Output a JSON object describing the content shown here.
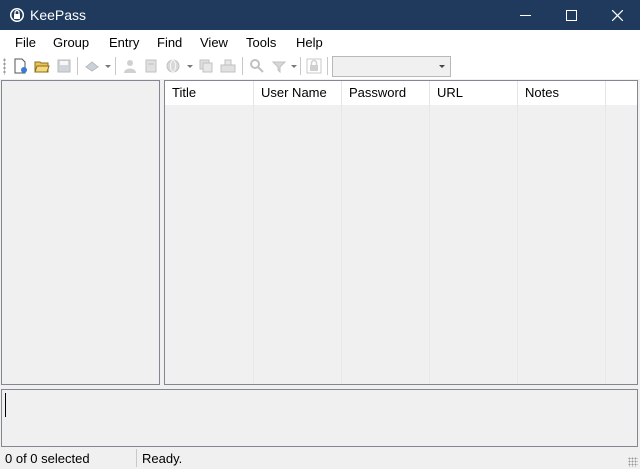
{
  "window": {
    "title": "KeePass",
    "icon": "keepass-lock-icon",
    "controls": [
      "minimize-icon",
      "maximize-icon",
      "close-icon"
    ],
    "titlebar_color": "#1f3a5c"
  },
  "menu": {
    "items": [
      "File",
      "Group",
      "Entry",
      "Find",
      "View",
      "Tools",
      "Help"
    ]
  },
  "toolbar": {
    "buttons": [
      {
        "icon": "new-database-icon",
        "enabled": true
      },
      {
        "icon": "open-database-icon",
        "enabled": true
      },
      {
        "icon": "save-database-icon",
        "enabled": false
      },
      {
        "icon": "add-entry-icon",
        "enabled": false
      },
      {
        "icon": "copy-username-icon",
        "enabled": false
      },
      {
        "icon": "copy-password-icon",
        "enabled": false
      },
      {
        "icon": "open-url-icon",
        "enabled": false
      },
      {
        "icon": "copy-entry-icon",
        "enabled": false
      },
      {
        "icon": "autotype-icon",
        "enabled": false
      },
      {
        "icon": "find-icon",
        "enabled": false
      },
      {
        "icon": "show-entries-icon",
        "enabled": false
      },
      {
        "icon": "lock-workspace-icon",
        "enabled": false
      }
    ],
    "quick_find_value": ""
  },
  "entry_list": {
    "columns": [
      "Title",
      "User Name",
      "Password",
      "URL",
      "Notes"
    ]
  },
  "status": {
    "selection": "0 of 0 selected",
    "state": "Ready."
  }
}
